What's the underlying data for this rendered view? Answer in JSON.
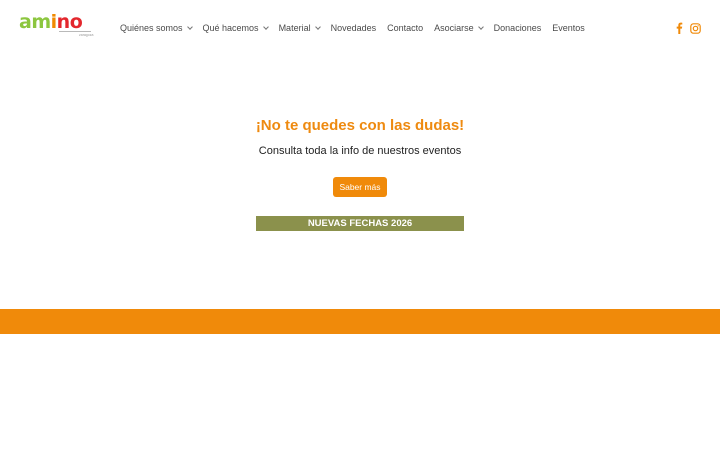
{
  "logo": {
    "letters": [
      "a",
      "m",
      "i",
      "n",
      "o"
    ],
    "tagline": "zaragoza"
  },
  "nav": {
    "items": [
      {
        "label": "Quiénes somos",
        "has_dropdown": true
      },
      {
        "label": "Qué hacemos",
        "has_dropdown": true
      },
      {
        "label": "Material",
        "has_dropdown": true
      },
      {
        "label": "Novedades",
        "has_dropdown": false
      },
      {
        "label": "Contacto",
        "has_dropdown": false
      },
      {
        "label": "Asociarse",
        "has_dropdown": true
      },
      {
        "label": "Donaciones",
        "has_dropdown": false
      },
      {
        "label": "Eventos",
        "has_dropdown": false
      }
    ]
  },
  "social": {
    "icons": [
      "facebook-icon",
      "instagram-icon"
    ],
    "color": "#f08a0a"
  },
  "hero": {
    "title": "¡No te quedes con las dudas!",
    "subtitle": "Consulta toda la info de nuestros eventos",
    "button_label": "Saber más",
    "band_text": "NUEVAS FECHAS 2026"
  },
  "colors": {
    "accent": "#f08a0a",
    "band": "#8b914c",
    "logo_green": "#8cc63f",
    "logo_red": "#e3272d"
  }
}
